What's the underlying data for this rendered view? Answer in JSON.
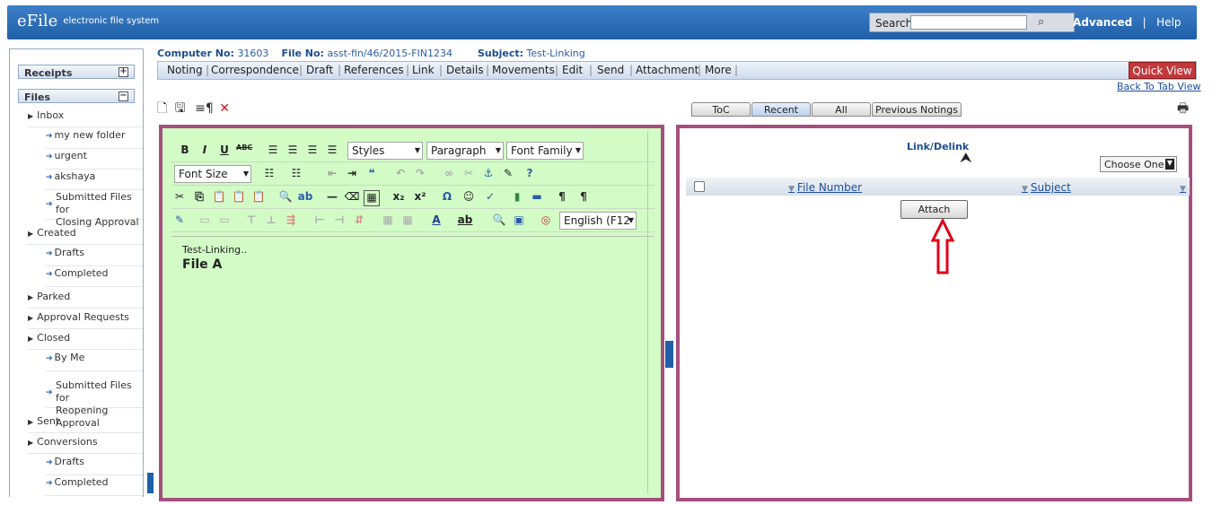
{
  "header": {
    "logo": "eFile",
    "tagline": "electronic file system",
    "search_label": "Search",
    "search_value": "",
    "advanced": "Advanced",
    "sep": "|",
    "help": "Help"
  },
  "sidebar": {
    "receipts": "Receipts",
    "receipts_toggle": "+",
    "files": "Files",
    "files_toggle": "−",
    "items": [
      "Inbox",
      "my new folder",
      "urgent",
      "akshaya",
      "Submitted Files for",
      "Closing Approval",
      "Created",
      "Drafts",
      "Completed",
      "Parked",
      "Approval Requests",
      "Closed",
      "By Me",
      "Submitted Files for",
      "Reopening Approval",
      "Sent",
      "Conversions",
      "Drafts",
      "Completed"
    ]
  },
  "meta": {
    "computer_label": "Computer No:",
    "computer_value": "31603",
    "file_label": "File No:",
    "file_value": "asst-fin/46/2015-FIN1234",
    "subject_label": "Subject:",
    "subject_value": "Test-Linking"
  },
  "tabs": [
    "Noting",
    "Correspondence",
    "Draft",
    "References",
    "Link",
    "Details",
    "Movements",
    "Edit",
    "Send",
    "Attachment",
    "More"
  ],
  "quick_view": "Quick View",
  "back_to_tab": "Back To Tab View",
  "editor": {
    "styles": "Styles",
    "paragraph": "Paragraph",
    "font_family": "Font Family",
    "font_size": "Font Size",
    "language": "English (F12",
    "content_line1": "Test-Linking..",
    "content_line2": "File A"
  },
  "right": {
    "tabs": [
      "ToC",
      "Recent",
      "All",
      "Previous Notings"
    ],
    "active_tab": "Recent",
    "title": "Link/Delink",
    "choose": "Choose One",
    "columns": [
      "File Number",
      "Subject"
    ],
    "attach": "Attach",
    "arrow_color": "#e0001b"
  }
}
